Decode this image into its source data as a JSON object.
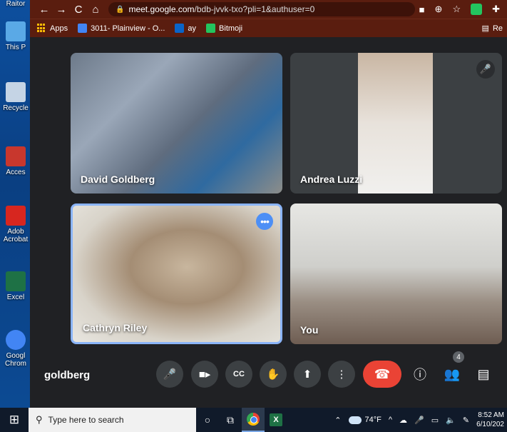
{
  "desktop": {
    "top_label": "Raitor",
    "icons": [
      {
        "label": "This P",
        "color": "#5aa9e6"
      },
      {
        "label": "Recycle",
        "color": "#c5d4e5"
      },
      {
        "label": "Acces",
        "color": "#c8372d"
      },
      {
        "label": "Adob Acrobat",
        "color": "#d7261f"
      },
      {
        "label": "Excel",
        "color": "#1e7145"
      },
      {
        "label": "Googl Chrom",
        "color": "#4285f4"
      }
    ]
  },
  "browser": {
    "nav": {
      "back": "←",
      "forward": "→",
      "reload": "C",
      "home": "⌂"
    },
    "url_host": "meet.google.com",
    "url_path": "/bdb-jvvk-txo?pli=1&authuser=0",
    "bookmarks": [
      {
        "label": "Apps"
      },
      {
        "label": "3011- Plainview - O..."
      },
      {
        "label": "ay"
      },
      {
        "label": "Bitmoji"
      }
    ],
    "reading_list": "Re"
  },
  "meet": {
    "participants": [
      {
        "name": "David Goldberg"
      },
      {
        "name": "Andrea Luzzi"
      },
      {
        "name": "Cathryn Riley"
      },
      {
        "name": "You"
      }
    ],
    "meeting_name": "goldberg",
    "participant_count": "4"
  },
  "taskbar": {
    "search_placeholder": "Type here to search",
    "weather": "74°F",
    "time": "8:52 AM",
    "date": "6/10/202"
  }
}
